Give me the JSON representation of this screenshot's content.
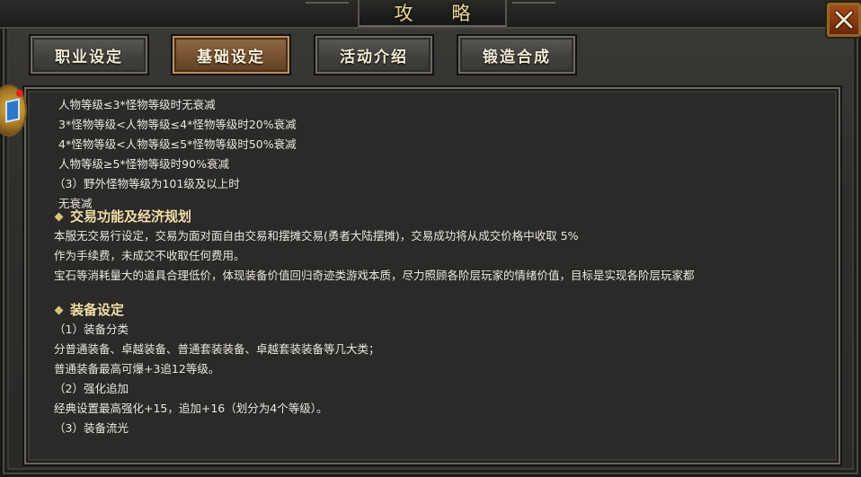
{
  "window": {
    "title": "攻 略",
    "close_icon": "close-x-icon",
    "side_icon": "quest-book-icon",
    "accent_color": "#e9d792"
  },
  "tabs": [
    {
      "label": "职业设定",
      "active": false
    },
    {
      "label": "基础设定",
      "active": true
    },
    {
      "label": "活动介绍",
      "active": false
    },
    {
      "label": "锻造合成",
      "active": false
    }
  ],
  "content": {
    "decay_lines": [
      "人物等级≤3*怪物等级时无衰减",
      "3*怪物等级<人物等级≤4*怪物等级时20%衰减",
      "4*怪物等级<人物等级≤5*怪物等级时50%衰减",
      "人物等级≥5*怪物等级时90%衰减",
      "（3）野外怪物等级为101级及以上时",
      "无衰减"
    ],
    "trade_section": {
      "title": "交易功能及经济规划",
      "lines": [
        "本服无交易行设定，交易为面对面自由交易和摆摊交易(勇者大陆摆摊)，交易成功将从成交价格中收取 5%",
        "作为手续费，未成交不收取任何费用。",
        "宝石等消耗量大的道具合理低价，体现装备价值回归奇迹类游戏本质，尽力照顾各阶层玩家的情绪价值，目标是实现各阶层玩家都"
      ]
    },
    "equip_section": {
      "title": "装备设定",
      "lines": [
        "（1）装备分类",
        "分普通装备、卓越装备、普通套装装备、卓越套装装备等几大类；",
        "普通装备最高可爆+3追12等级。",
        "（2）强化追加",
        "经典设置最高强化+15，追加+16（划分为4个等级）。",
        "（3）装备流光"
      ]
    }
  }
}
